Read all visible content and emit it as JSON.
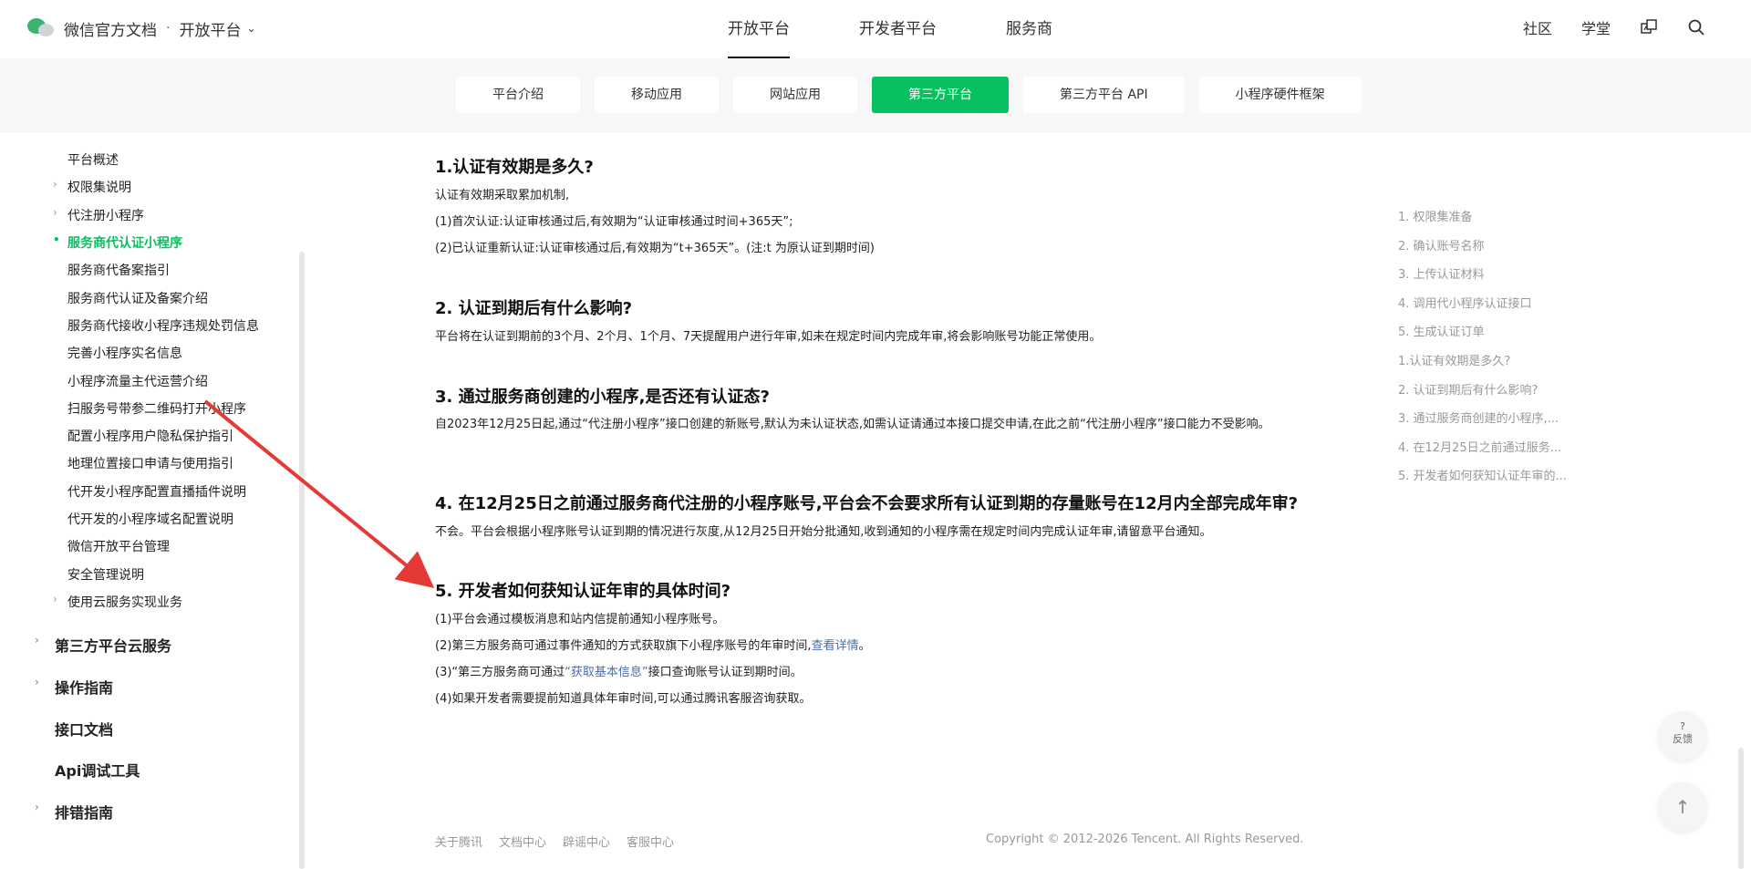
{
  "header": {
    "brand": "微信官方文档",
    "dot": "·",
    "platform": "开放平台",
    "main_nav": [
      "开放平台",
      "开发者平台",
      "服务商"
    ],
    "right_nav": [
      "社区",
      "学堂"
    ]
  },
  "subnav": [
    "平台介绍",
    "移动应用",
    "网站应用",
    "第三方平台",
    "第三方平台 API",
    "小程序硬件框架"
  ],
  "sidebar": {
    "items": [
      {
        "label": "平台概述",
        "arrow": false,
        "active": false
      },
      {
        "label": "权限集说明",
        "arrow": true,
        "active": false
      },
      {
        "label": "代注册小程序",
        "arrow": true,
        "active": false
      },
      {
        "label": "服务商代认证小程序",
        "arrow": false,
        "active": true
      },
      {
        "label": "服务商代备案指引",
        "arrow": false,
        "active": false
      },
      {
        "label": "服务商代认证及备案介绍",
        "arrow": false,
        "active": false
      },
      {
        "label": "服务商代接收小程序违规处罚信息",
        "arrow": false,
        "active": false
      },
      {
        "label": "完善小程序实名信息",
        "arrow": false,
        "active": false
      },
      {
        "label": "小程序流量主代运营介绍",
        "arrow": false,
        "active": false
      },
      {
        "label": "扫服务号带参二维码打开小程序",
        "arrow": false,
        "active": false
      },
      {
        "label": "配置小程序用户隐私保护指引",
        "arrow": false,
        "active": false
      },
      {
        "label": "地理位置接口申请与使用指引",
        "arrow": false,
        "active": false
      },
      {
        "label": "代开发小程序配置直播插件说明",
        "arrow": false,
        "active": false
      },
      {
        "label": "代开发的小程序域名配置说明",
        "arrow": false,
        "active": false
      },
      {
        "label": "微信开放平台管理",
        "arrow": false,
        "active": false
      },
      {
        "label": "安全管理说明",
        "arrow": false,
        "active": false
      },
      {
        "label": "使用云服务实现业务",
        "arrow": true,
        "active": false
      }
    ],
    "sections": [
      {
        "label": "第三方平台云服务",
        "arrow": true
      },
      {
        "label": "操作指南",
        "arrow": true
      },
      {
        "label": "接口文档",
        "arrow": false
      },
      {
        "label": "Api调试工具",
        "arrow": false
      },
      {
        "label": "排错指南",
        "arrow": true
      }
    ]
  },
  "content": {
    "q1_title": "1.认证有效期是多久?",
    "q1_p1": "认证有效期采取累加机制,",
    "q1_p2": "(1)首次认证:认证审核通过后,有效期为“认证审核通过时间+365天”;",
    "q1_p3": "(2)已认证重新认证:认证审核通过后,有效期为“t+365天”。(注:t 为原认证到期时间)",
    "q2_title": "2. 认证到期后有什么影响?",
    "q2_p1": "平台将在认证到期前的3个月、2个月、1个月、7天提醒用户进行年审,如未在规定时间内完成年审,将会影响账号功能正常使用。",
    "q3_title": "3. 通过服务商创建的小程序,是否还有认证态?",
    "q3_p1": "自2023年12月25日起,通过“代注册小程序”接口创建的新账号,默认为未认证状态,如需认证请通过本接口提交申请,在此之前“代注册小程序”接口能力不受影响。",
    "q4_title": "4. 在12月25日之前通过服务商代注册的小程序账号,平台会不会要求所有认证到期的存量账号在12月内全部完成年审?",
    "q4_p1": "不会。平台会根据小程序账号认证到期的情况进行灰度,从12月25日开始分批通知,收到通知的小程序需在规定时间内完成认证年审,请留意平台通知。",
    "q5_title": "5. 开发者如何获知认证年审的具体时间?",
    "q5_p1": "(1)平台会通过模板消息和站内信提前通知小程序账号。",
    "q5_p2_pre": "(2)第三方服务商可通过事件通知的方式获取旗下小程序账号的年审时间,",
    "q5_p2_link": "查看详情",
    "q5_p2_post": "。",
    "q5_p3_pre": "(3)“第三方服务商可通过",
    "q5_p3_link": "“获取基本信息”",
    "q5_p3_post": "接口查询账号认证到期时间。",
    "q5_p4": "(4)如果开发者需要提前知道具体年审时间,可以通过腾讯客服咨询获取。"
  },
  "toc": [
    "1. 权限集准备",
    "2. 确认账号名称",
    "3. 上传认证材料",
    "4. 调用代小程序认证接口",
    "5. 生成认证订单",
    "1.认证有效期是多久?",
    "2. 认证到期后有什么影响?",
    "3. 通过服务商创建的小程序,...",
    "4. 在12月25日之前通过服务...",
    "5. 开发者如何获知认证年审的..."
  ],
  "footer": {
    "links": [
      "关于腾讯",
      "文档中心",
      "辟谣中心",
      "客服中心"
    ],
    "copyright": "Copyright © 2012-2026 Tencent. All Rights Reserved."
  },
  "float": {
    "feedback_q": "?",
    "feedback_label": "反馈",
    "top_arrow": "↑"
  },
  "colors": {
    "accent": "#07c160",
    "link": "#4a6ea9",
    "annotation_arrow": "#e53935"
  }
}
